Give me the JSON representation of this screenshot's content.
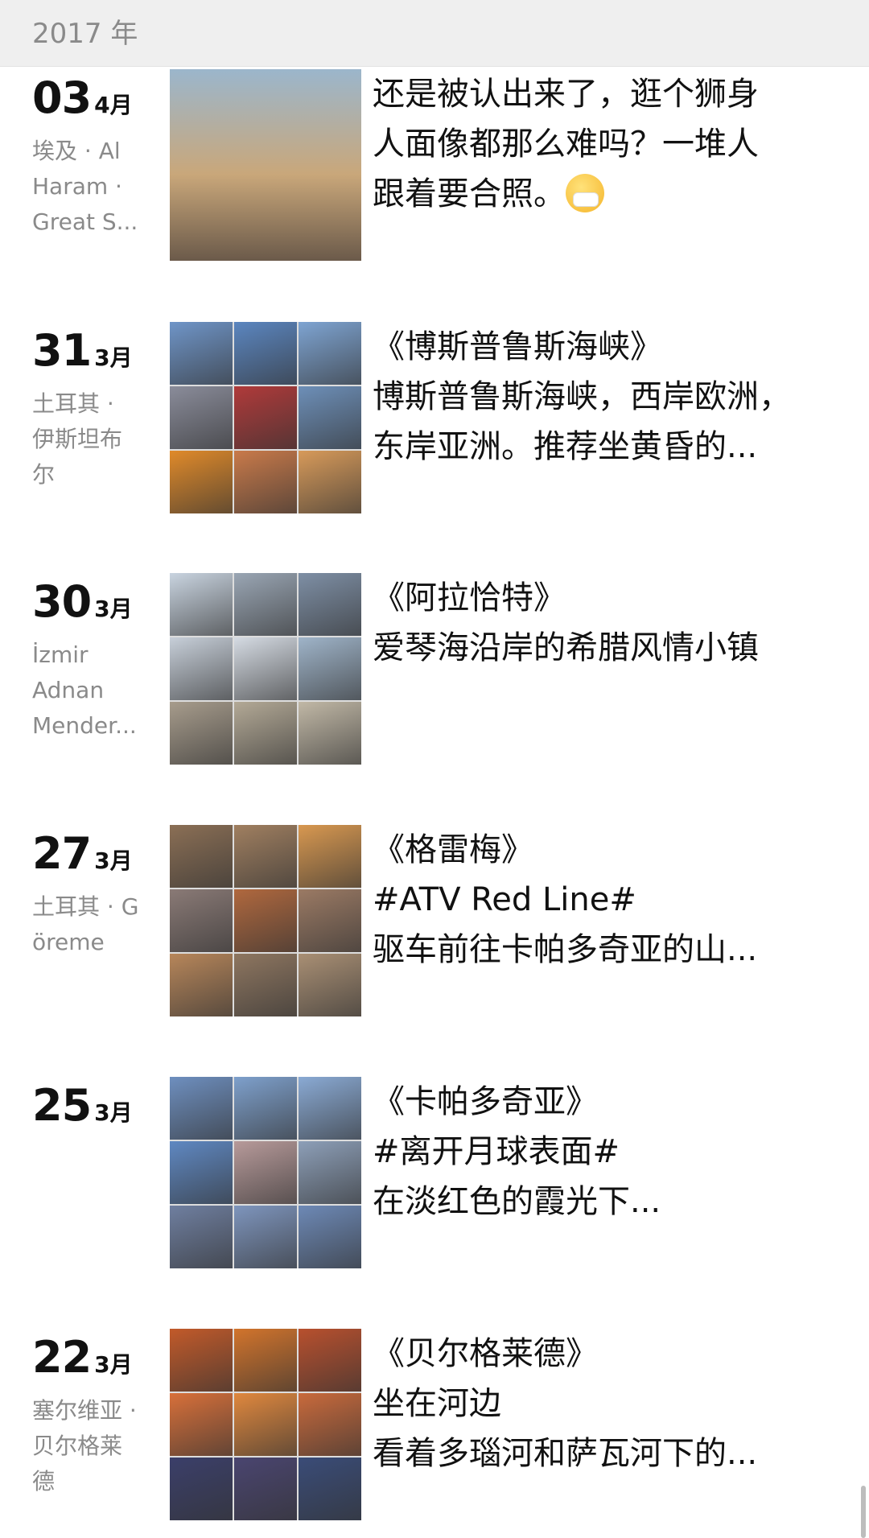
{
  "year_header": "2017 年",
  "posts": [
    {
      "day": "03",
      "month": "4月",
      "location_lines": [
        "埃及 · Al",
        "Haram ·",
        "Great S..."
      ],
      "lines": [
        "还是被认出来了，逛个狮身",
        "人面像都那么难吗？一堆人",
        "跟着要合照。"
      ],
      "photo_count": 1,
      "photo_colors": [
        "#9bb6cc"
      ]
    },
    {
      "day": "31",
      "month": "3月",
      "location_lines": [
        "土耳其 ·",
        "伊斯坦布",
        "尔"
      ],
      "lines": [
        "《博斯普鲁斯海峡》",
        "博斯普鲁斯海峡，西岸欧洲，",
        "东岸亚洲。推荐坐黄昏的..."
      ],
      "photo_count": 9,
      "photo_colors": [
        "#6f95c8",
        "#5b86c0",
        "#7ea4d2",
        "#8a8c9a",
        "#b03a3a",
        "#6d8fb8",
        "#e08a2a",
        "#c97a4a",
        "#d79a5a"
      ]
    },
    {
      "day": "30",
      "month": "3月",
      "location_lines": [
        "İzmir",
        "Adnan",
        "Mender..."
      ],
      "lines": [
        "《阿拉恰特》",
        "爱琴海沿岸的希腊风情小镇"
      ],
      "photo_count": 9,
      "photo_colors": [
        "#c9d4e0",
        "#9aa6b4",
        "#7e8fa5",
        "#c7cfd9",
        "#d5dbe3",
        "#9fb4c9",
        "#a79c8c",
        "#b3a996",
        "#c1b8a6"
      ]
    },
    {
      "day": "27",
      "month": "3月",
      "location_lines": [
        "土耳其 · G",
        "öreme"
      ],
      "lines": [
        "《格雷梅》",
        "#ATV Red Line#",
        "驱车前往卡帕多奇亚的山..."
      ],
      "photo_count": 9,
      "photo_colors": [
        "#8b6f55",
        "#a07f60",
        "#d89850",
        "#8a7a76",
        "#b0683e",
        "#9b7a64",
        "#b7865a",
        "#8e7660",
        "#a98f74"
      ]
    },
    {
      "day": "25",
      "month": "3月",
      "location_lines": [],
      "lines": [
        "《卡帕多奇亚》",
        "#离开月球表面#",
        "在淡红色的霞光下..."
      ],
      "photo_count": 9,
      "photo_colors": [
        "#6e8fbf",
        "#7ea0cc",
        "#8aaad4",
        "#5f88c2",
        "#b79a9a",
        "#8d9fb8",
        "#6f7fa0",
        "#7e95bd",
        "#6d89b6"
      ]
    },
    {
      "day": "22",
      "month": "3月",
      "location_lines": [
        "塞尔维亚 ·",
        "贝尔格莱",
        "德"
      ],
      "lines": [
        "《贝尔格莱德》",
        "坐在河边",
        "看着多瑙河和萨瓦河下的..."
      ],
      "photo_count": 9,
      "photo_colors": [
        "#c25a2a",
        "#d2742c",
        "#b8502e",
        "#d8703a",
        "#e0883e",
        "#c96a3c",
        "#3b3f6a",
        "#4a4570",
        "#3a4c78"
      ]
    }
  ]
}
